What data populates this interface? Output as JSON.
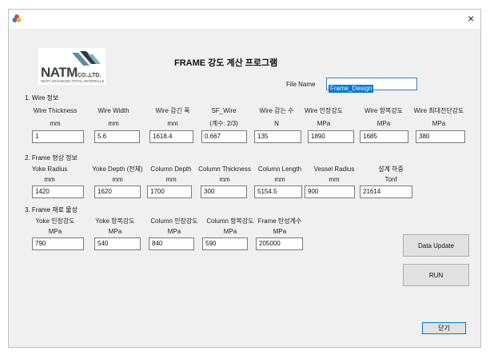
{
  "window": {
    "close_glyph": "×"
  },
  "logo": {
    "main": "NATM",
    "suffix": "CO.,LTD.",
    "tagline": "NEXT ADVANCED TOTAL MATERIALS"
  },
  "program_title": "FRAME 강도 계산 프로그램",
  "file_name": {
    "label": "File Name",
    "value": "Frame_Design"
  },
  "sections": {
    "wire": "1. Wire 정보",
    "frame": "2. Frame 형상 정보",
    "material": "3. Frame 재료 물성"
  },
  "wire_fields": [
    {
      "label": "Wire Thickness",
      "unit": "mm",
      "value": "1"
    },
    {
      "label": "Wire Width",
      "unit": "mm",
      "value": "5.6"
    },
    {
      "label": "Wire 감긴 폭",
      "unit": "mm",
      "value": "1618.4"
    },
    {
      "label": "SF_Wire",
      "unit": "(계수: 2/3)",
      "value": "0.667"
    },
    {
      "label": "Wire 감는 수",
      "unit": "N",
      "value": "135"
    },
    {
      "label": "Wire 인장강도",
      "unit": "MPa",
      "value": "1890"
    },
    {
      "label": "Wire 항복강도",
      "unit": "MPa",
      "value": "1685"
    },
    {
      "label": "Wire 최대전단강도",
      "unit": "MPa",
      "value": "380"
    }
  ],
  "frame_fields": [
    {
      "label": "Yoke Radius",
      "unit": "mm",
      "value": "1420"
    },
    {
      "label": "Yoke Depth (전체)",
      "unit": "mm",
      "value": "1620"
    },
    {
      "label": "Column Depth",
      "unit": "mm",
      "value": "1700"
    },
    {
      "label": "Column Thickness",
      "unit": "mm",
      "value": "300"
    },
    {
      "label": "Column Length",
      "unit": "mm",
      "value": "5154.5"
    },
    {
      "label": "Vessel Radius",
      "unit": "mm",
      "value": "900"
    },
    {
      "label": "설계 하중",
      "unit": "Tonf",
      "value": "21614"
    }
  ],
  "material_fields": [
    {
      "label": "Yoke 인장강도",
      "unit": "MPa",
      "value": "790"
    },
    {
      "label": "Yoke 항복강도",
      "unit": "MPa",
      "value": "540"
    },
    {
      "label": "Column 인장강도",
      "unit": "MPa",
      "value": "840"
    },
    {
      "label": "Column 항복강도",
      "unit": "MPa",
      "value": "590"
    },
    {
      "label": "Frame 탄성계수",
      "unit": "MPa",
      "value": "205000"
    }
  ],
  "buttons": {
    "data_update": "Data Update",
    "run": "RUN",
    "close": "닫기"
  },
  "colors": {
    "selection": "#0078d7",
    "form_bg": "#f0f0f0",
    "logo_dark": "#2f3a48",
    "logo_teal": "#4a8fa0"
  }
}
